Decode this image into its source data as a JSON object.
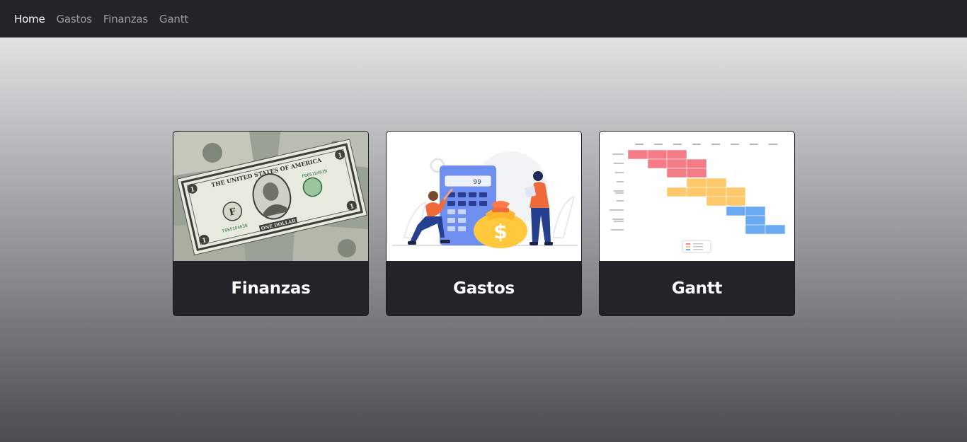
{
  "navbar": {
    "items": [
      {
        "label": "Home",
        "active": true
      },
      {
        "label": "Gastos",
        "active": false
      },
      {
        "label": "Finanzas",
        "active": false
      },
      {
        "label": "Gantt",
        "active": false
      }
    ]
  },
  "cards": [
    {
      "title": "Finanzas",
      "image": "dollar-bill-photo"
    },
    {
      "title": "Gastos",
      "image": "calculator-moneybag-illustration"
    },
    {
      "title": "Gantt",
      "image": "gantt-chart-thumbnail"
    }
  ],
  "images": {
    "dollar": {
      "serial": "F06518463N",
      "banner": "THE UNITED STATES OF AMERICA",
      "denomination": "ONE DOLLAR",
      "digit": "1",
      "seal_letter": "F"
    },
    "calculator": {
      "display": "99",
      "bag_symbol": "$"
    }
  },
  "colors": {
    "navbar_bg": "#212529",
    "card_bg": "#212529",
    "gantt_red": "#f47c86",
    "gantt_yellow": "#ffc96b",
    "gantt_blue": "#6aaaf2"
  }
}
